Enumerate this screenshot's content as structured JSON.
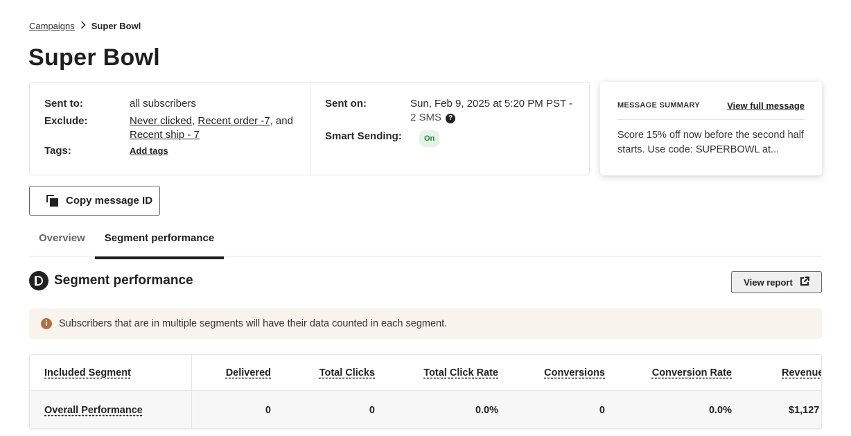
{
  "breadcrumb": {
    "parent": "Campaigns",
    "current": "Super Bowl"
  },
  "page_title": "Super Bowl",
  "details": {
    "sent_to_label": "Sent to:",
    "sent_to_value": "all subscribers",
    "exclude_label": "Exclude:",
    "exclude_items": [
      "Never clicked",
      "Recent order -7",
      "Recent ship - 7"
    ],
    "exclude_sep1": ", ",
    "exclude_sep2": ", and ",
    "tags_label": "Tags:",
    "add_tags": "Add tags",
    "sent_on_label": "Sent on:",
    "sent_on_value": "Sun, Feb 9, 2025 at 5:20 PM PST -",
    "sent_on_sub": "2 SMS",
    "help_glyph": "?",
    "smart_sending_label": "Smart Sending:",
    "smart_sending_value": "On"
  },
  "summary": {
    "label": "MESSAGE SUMMARY",
    "view_link": "View full message",
    "text": "Score 15% off now before the second half starts. Use code: SUPERBOWL at..."
  },
  "copy_button": "Copy message ID",
  "tabs": [
    {
      "label": "Overview",
      "active": false
    },
    {
      "label": "Segment performance",
      "active": true
    }
  ],
  "section": {
    "title": "Segment performance",
    "view_report": "View report"
  },
  "notice": {
    "icon_glyph": "i",
    "text": "Subscribers that are in multiple segments will have their data counted in each segment."
  },
  "table": {
    "columns": [
      "Included Segment",
      "Delivered",
      "Total Clicks",
      "Total Click Rate",
      "Conversions",
      "Conversion Rate",
      "Revenue"
    ],
    "rows": [
      [
        "Overall Performance",
        "0",
        "0",
        "0.0%",
        "0",
        "0.0%",
        "$1,127"
      ]
    ]
  },
  "colors": {
    "accent": "#1f1f1f",
    "notice_bg": "#f8f3ec",
    "info_icon": "#b0714a",
    "badge_bg": "#e3f3e6",
    "badge_text": "#2e7d3e"
  },
  "icons": {
    "copy": "copy-icon",
    "external": "external-link-icon",
    "segment": "segment-icon",
    "info": "info-icon",
    "help": "help-icon",
    "chevron": "chevron-right-icon"
  }
}
